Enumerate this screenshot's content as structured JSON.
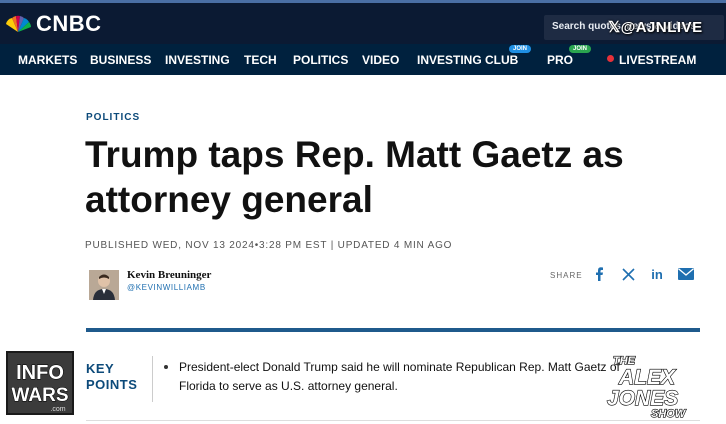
{
  "header": {
    "brand": "CNBC",
    "search_placeholder": "Search quotes, news & videos",
    "colors": {
      "topbar": "#0b1a33",
      "navbar": "#00213e",
      "live": "#e6313a"
    }
  },
  "nav": {
    "items": [
      "MARKETS",
      "BUSINESS",
      "INVESTING",
      "TECH",
      "POLITICS",
      "VIDEO",
      "INVESTING CLUB",
      "PRO",
      "LIVESTREAM"
    ],
    "investing_club_badge": "JOIN",
    "pro_badge": "JOIN"
  },
  "overlay": {
    "top_watermark": "@AJNLIVE",
    "left_logo": "INFOWARS",
    "left_logo_sub": ".com",
    "right_logo_lines": [
      "THE",
      "ALEX",
      "JONES",
      "SHOW"
    ]
  },
  "article": {
    "section": "POLITICS",
    "headline_line1": "Trump taps Rep. Matt Gaetz as",
    "headline_line2": "attorney general",
    "published": "PUBLISHED WED, NOV 13 2024•3:28 PM EST | UPDATED 4 MIN AGO",
    "author": "Kevin Breuninger",
    "handle": "@KEVINWILLIAMB",
    "share_label": "SHARE",
    "share_icons": [
      "facebook-icon",
      "x-icon",
      "linkedin-icon",
      "email-icon"
    ],
    "key_points_line1": "KEY",
    "key_points_line2": "POINTS",
    "key_point_1": "President-elect Donald Trump said he will nominate Republican Rep. Matt Gaetz of Florida to serve as U.S. attorney general."
  }
}
